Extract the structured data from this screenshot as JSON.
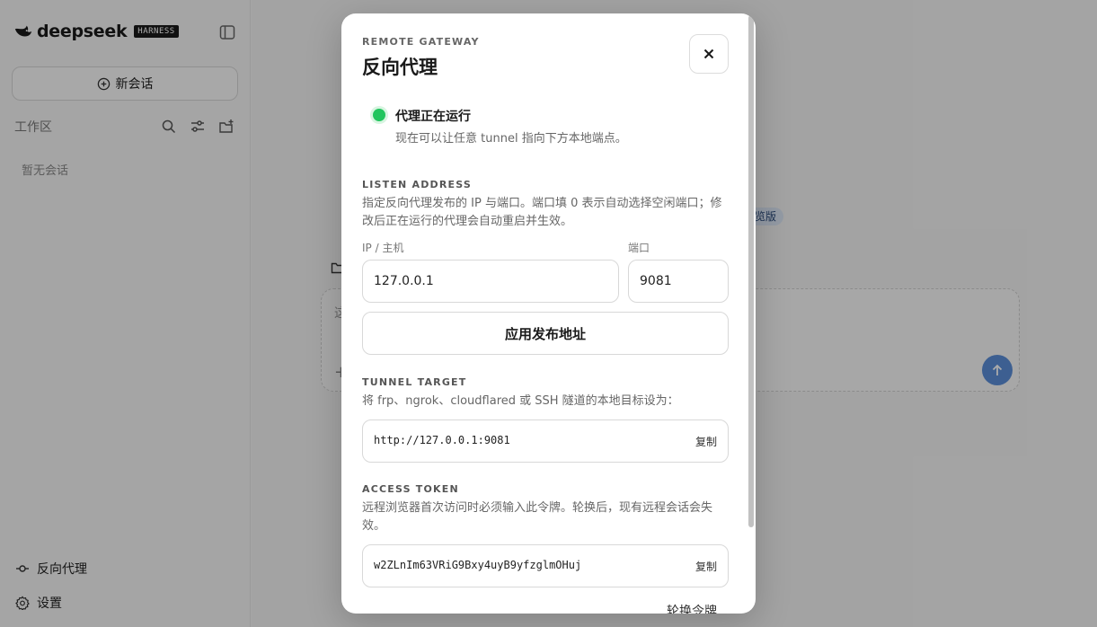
{
  "sidebar": {
    "brand": "deepseek",
    "badge": "HARNESS",
    "new_chat_label": "新会话",
    "workspace_label": "工作区",
    "empty_text": "暂无会话",
    "proxy_label": "反向代理",
    "settings_label": "设置"
  },
  "main": {
    "preview_badge": "览版",
    "composer_placeholder": "这",
    "composer_plus": "+"
  },
  "modal": {
    "eyebrow": "REMOTE GATEWAY",
    "title": "反向代理",
    "status_title": "代理正在运行",
    "status_desc": "现在可以让任意 tunnel 指向下方本地端点。",
    "listen": {
      "label": "LISTEN ADDRESS",
      "desc": "指定反向代理发布的 IP 与端口。端口填 0 表示自动选择空闲端口；修改后正在运行的代理会自动重启并生效。",
      "host_label": "IP / 主机",
      "host_value": "127.0.0.1",
      "port_label": "端口",
      "port_value": "9081",
      "apply_label": "应用发布地址"
    },
    "tunnel": {
      "label": "TUNNEL TARGET",
      "desc": "将 frp、ngrok、cloudflared 或 SSH 隧道的本地目标设为：",
      "value": "http://127.0.0.1:9081",
      "copy_label": "复制"
    },
    "token": {
      "label": "ACCESS TOKEN",
      "desc": "远程浏览器首次访问时必须输入此令牌。轮换后，现有远程会话会失效。",
      "value": "w2ZLnIm63VRiG9Bxy4uyB9yfzglmOHuj",
      "copy_label": "复制",
      "rotate_label": "轮换令牌"
    }
  },
  "colors": {
    "status_ok": "#22c55e",
    "send_button": "#5b8ed8",
    "overlay": "rgba(0,0,0,0.33)"
  }
}
